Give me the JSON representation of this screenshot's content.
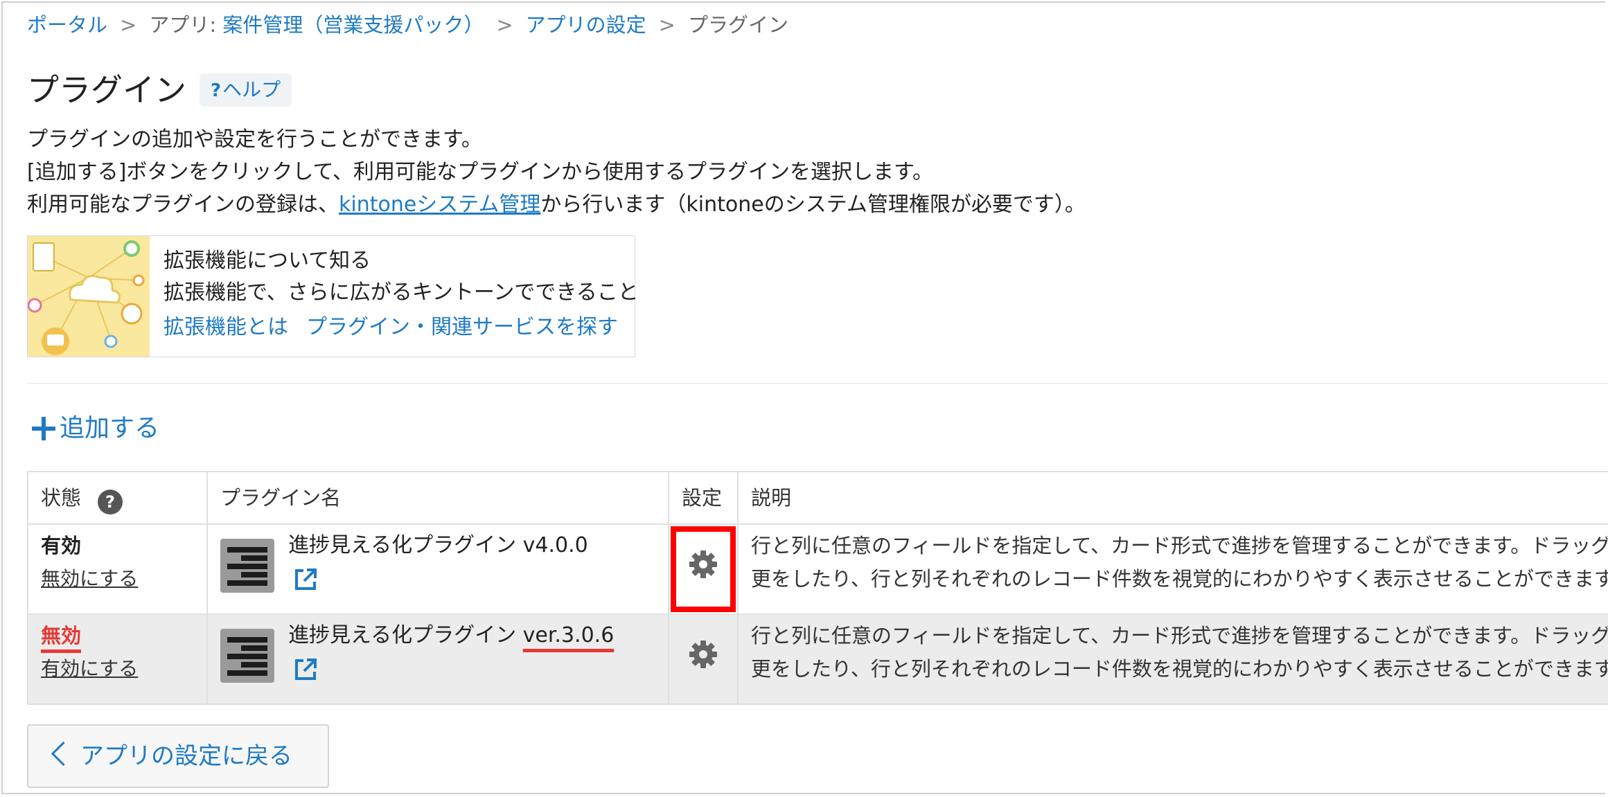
{
  "breadcrumb": {
    "portal": "ポータル",
    "app_prefix": "アプリ: ",
    "app_name": "案件管理（営業支援パック）",
    "app_settings": "アプリの設定",
    "current": "プラグイン",
    "separator": ">"
  },
  "header": {
    "title": "プラグイン",
    "help_q": "?",
    "help_label": "ヘルプ"
  },
  "description": {
    "line1": "プラグインの追加や設定を行うことができます。",
    "line2": "[追加する]ボタンをクリックして、利用可能なプラグインから使用するプラグインを選択します。",
    "line3_before": "利用可能なプラグインの登録は、",
    "line3_link": "kintoneシステム管理",
    "line3_after": "から行います（kintoneのシステム管理権限が必要です）。"
  },
  "promo": {
    "title": "拡張機能について知る",
    "subtitle": "拡張機能で、さらに広がるキントーンでできること",
    "link1": "拡張機能とは",
    "link2": "プラグイン・関連サービスを探す"
  },
  "actions": {
    "add_label": "追加する",
    "back_label": "アプリの設定に戻る"
  },
  "table": {
    "headers": {
      "status": "状態",
      "status_help": "?",
      "name": "プラグイン名",
      "settings": "設定",
      "description": "説明"
    },
    "rows": [
      {
        "status": "有効",
        "toggle": "無効にする",
        "name": "進捗見える化プラグイン ",
        "version": "v4.0.0",
        "desc1": "行と列に任意のフィールドを指定して、カード形式で進捗を管理することができます。ドラッグ＆ドロップで簡単にステータスの変",
        "desc2": "更をしたり、行と列それぞれのレコード件数を視覚的にわかりやすく表示させることができます。",
        "state": "enabled",
        "settings_highlighted": true
      },
      {
        "status": "無効",
        "toggle": "有効にする",
        "name": "進捗見える化プラグイン ",
        "version": "ver.3.0.6",
        "desc1": "行と列に任意のフィールドを指定して、カード形式で進捗を管理することができます。ドラッグ＆ドロップで簡単にステータスの変",
        "desc2": "更をしたり、行と列それぞれのレコード件数を視覚的にわかりやすく表示させることができます。",
        "state": "disabled",
        "settings_highlighted": false
      }
    ]
  },
  "colors": {
    "link": "#1e7ac4",
    "disabled_status": "#e53935",
    "highlight_box": "#ff0000",
    "disabled_row_bg": "#ececec"
  },
  "icons": {
    "settings": "gear-icon",
    "external": "external-link-icon",
    "add": "plus-icon",
    "back": "chevron-left-icon",
    "help": "question-circle-icon"
  }
}
